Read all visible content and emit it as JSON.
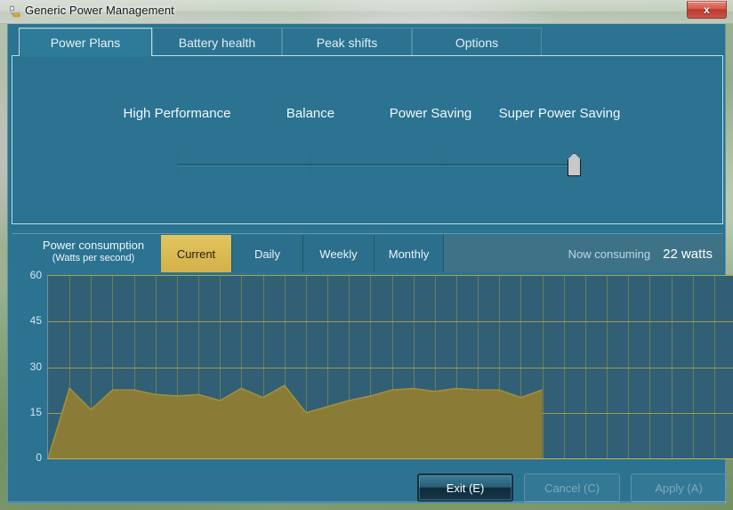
{
  "window": {
    "title": "Generic Power Management",
    "icon": "power-plug-icon",
    "close_label": "x",
    "accent_color": "#2b7391",
    "chart_accent_color": "#a08f3e"
  },
  "tabs": [
    {
      "label": "Power Plans",
      "active": true
    },
    {
      "label": "Battery health",
      "active": false
    },
    {
      "label": "Peak shifts",
      "active": false
    },
    {
      "label": "Options",
      "active": false
    }
  ],
  "power_plans": {
    "labels": [
      "High Performance",
      "Balance",
      "Power Saving",
      "Super Power Saving"
    ],
    "selected_index": 3,
    "selected_label": "Super Power Saving"
  },
  "consumption": {
    "title_line1": "Power consumption",
    "title_line2": "(Watts per second)",
    "ranges": [
      {
        "label": "Current",
        "active": true
      },
      {
        "label": "Daily",
        "active": false
      },
      {
        "label": "Weekly",
        "active": false
      },
      {
        "label": "Monthly",
        "active": false
      }
    ],
    "now_consuming_label": "Now consuming",
    "now_consuming_value": "22 watts"
  },
  "buttons": [
    {
      "label": "Exit (E)",
      "state": "default-focused"
    },
    {
      "label": "Cancel (C)",
      "state": "disabled"
    },
    {
      "label": "Apply (A)",
      "state": "disabled"
    }
  ],
  "chart_data": {
    "type": "area",
    "title": "Power consumption (Watts per second)",
    "xlabel": "",
    "ylabel": "Watts per second",
    "ylim": [
      0,
      60
    ],
    "yticks": [
      0,
      15,
      30,
      45,
      60
    ],
    "ytick_labels": [
      "0",
      "15",
      "30",
      "45",
      "60"
    ],
    "grid": true,
    "grid_columns": 32,
    "legend": "none",
    "series_color": "#a08f3e",
    "fill_color": "#8a7c36",
    "plot_background": "#315f75",
    "x": [
      0,
      1,
      2,
      3,
      4,
      5,
      6,
      7,
      8,
      9,
      10,
      11,
      12,
      13,
      14,
      15,
      16,
      17,
      18,
      19,
      20,
      21,
      22,
      23
    ],
    "values": [
      0,
      23,
      16,
      22.5,
      22.5,
      21,
      20.5,
      21,
      19,
      23,
      20,
      24,
      15,
      17,
      19,
      20.5,
      22.5,
      23,
      22,
      23,
      22.5,
      22.5,
      20,
      22.5
    ],
    "points_plotted": 24,
    "x_capacity": 32
  }
}
